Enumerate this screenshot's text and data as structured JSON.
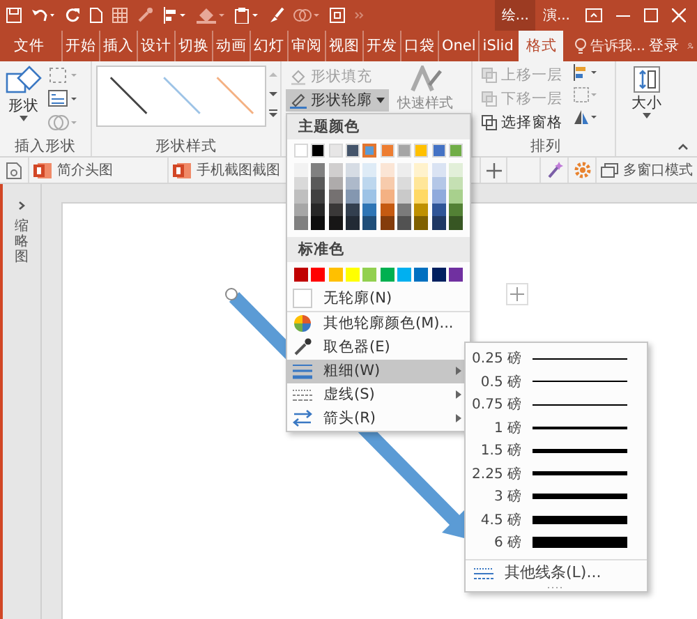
{
  "title_bar": {
    "context_tabs": [
      {
        "label": "绘...",
        "selected": true
      },
      {
        "label": "演...",
        "selected": false
      }
    ]
  },
  "ribbon_tabs": [
    {
      "label": "文件",
      "selected": false
    },
    {
      "label": "开始",
      "selected": false
    },
    {
      "label": "插入",
      "selected": false
    },
    {
      "label": "设计",
      "selected": false
    },
    {
      "label": "切换",
      "selected": false
    },
    {
      "label": "动画",
      "selected": false
    },
    {
      "label": "幻灯",
      "selected": false
    },
    {
      "label": "审阅",
      "selected": false
    },
    {
      "label": "视图",
      "selected": false
    },
    {
      "label": "开发",
      "selected": false
    },
    {
      "label": "口袋",
      "selected": false
    },
    {
      "label": "Onel",
      "selected": false
    },
    {
      "label": "iSlid",
      "selected": false
    },
    {
      "label": "格式",
      "selected": true
    }
  ],
  "tell_me": {
    "placeholder": "告诉我..."
  },
  "account": {
    "label": "登录"
  },
  "insert_shapes": {
    "button": "形状",
    "label": "插入形状"
  },
  "shape_styles": {
    "label": "形状样式"
  },
  "shape_fill": {
    "label": "形状填充",
    "disabled": true
  },
  "shape_outline": {
    "label": "形状轮廓",
    "expanded": true
  },
  "quick_styles": {
    "label": "快速样式"
  },
  "arrange": {
    "items": [
      {
        "label": "上移一层",
        "disabled": true
      },
      {
        "label": "下移一层",
        "disabled": true
      },
      {
        "label": "选择窗格",
        "disabled": false
      }
    ],
    "label": "排列"
  },
  "size": {
    "label": "大小"
  },
  "addin_bar": {
    "items": [
      {
        "label": "简介头图"
      },
      {
        "label": "手机截图截图"
      }
    ],
    "window_mode": "多窗口模式"
  },
  "side_panel": {
    "label": "缩略图"
  },
  "outline_menu": {
    "theme_header": "主题颜色",
    "theme_colors": [
      {
        "color": "#ffffff",
        "selected": false,
        "shades": [
          {
            "color": "#f2f2f2"
          },
          {
            "color": "#d9d9d9"
          },
          {
            "color": "#bfbfbf"
          },
          {
            "color": "#a6a6a6"
          },
          {
            "color": "#808080"
          }
        ]
      },
      {
        "color": "#000000",
        "selected": false,
        "shades": [
          {
            "color": "#808080"
          },
          {
            "color": "#595959"
          },
          {
            "color": "#404040"
          },
          {
            "color": "#262626"
          },
          {
            "color": "#0d0d0d"
          }
        ]
      },
      {
        "color": "#e7e6e6",
        "selected": false,
        "shades": [
          {
            "color": "#d0cece"
          },
          {
            "color": "#aeabab"
          },
          {
            "color": "#757171"
          },
          {
            "color": "#3a3838"
          },
          {
            "color": "#171616"
          }
        ]
      },
      {
        "color": "#44546a",
        "selected": false,
        "shades": [
          {
            "color": "#d6dce4"
          },
          {
            "color": "#adb9ca"
          },
          {
            "color": "#8497b0"
          },
          {
            "color": "#333f4f"
          },
          {
            "color": "#222a35"
          }
        ]
      },
      {
        "color": "#5b9bd5",
        "selected": true,
        "shades": [
          {
            "color": "#deebf6"
          },
          {
            "color": "#bdd7ee"
          },
          {
            "color": "#9dc3e6"
          },
          {
            "color": "#2e75b5"
          },
          {
            "color": "#1f4e79"
          }
        ]
      },
      {
        "color": "#ed7d31",
        "selected": false,
        "shades": [
          {
            "color": "#fbe5d5"
          },
          {
            "color": "#f7cbac"
          },
          {
            "color": "#f4b183"
          },
          {
            "color": "#c55a11"
          },
          {
            "color": "#843c0b"
          }
        ]
      },
      {
        "color": "#a5a5a5",
        "selected": false,
        "shades": [
          {
            "color": "#ededed"
          },
          {
            "color": "#dbdbdb"
          },
          {
            "color": "#c9c9c9"
          },
          {
            "color": "#7b7b7b"
          },
          {
            "color": "#525252"
          }
        ]
      },
      {
        "color": "#ffc000",
        "selected": false,
        "shades": [
          {
            "color": "#fff2cc"
          },
          {
            "color": "#ffe699"
          },
          {
            "color": "#ffd965"
          },
          {
            "color": "#bf9000"
          },
          {
            "color": "#7f6000"
          }
        ]
      },
      {
        "color": "#4472c4",
        "selected": false,
        "shades": [
          {
            "color": "#dae3f3"
          },
          {
            "color": "#b4c7e7"
          },
          {
            "color": "#8faadc"
          },
          {
            "color": "#2f5597"
          },
          {
            "color": "#1f3864"
          }
        ]
      },
      {
        "color": "#70ad47",
        "selected": false,
        "shades": [
          {
            "color": "#e2efd9"
          },
          {
            "color": "#c5e0b3"
          },
          {
            "color": "#a8d08d"
          },
          {
            "color": "#538135"
          },
          {
            "color": "#375623"
          }
        ]
      }
    ],
    "standard_header": "标准色",
    "standard_colors": [
      {
        "color": "#c00000"
      },
      {
        "color": "#ff0000"
      },
      {
        "color": "#ffc000"
      },
      {
        "color": "#ffff00"
      },
      {
        "color": "#92d050"
      },
      {
        "color": "#00b050"
      },
      {
        "color": "#00b0f0"
      },
      {
        "color": "#0070c0"
      },
      {
        "color": "#002060"
      },
      {
        "color": "#7030a0"
      }
    ],
    "items": [
      {
        "kind": "no-outline",
        "label": "无轮廓(N)",
        "selected": false
      },
      {
        "kind": "more-colors",
        "label": "其他轮廓颜色(M)...",
        "selected": false
      },
      {
        "kind": "eyedropper",
        "label": "取色器(E)",
        "selected": false
      },
      {
        "kind": "weight",
        "label": "粗细(W)",
        "submenu": true,
        "selected": true
      },
      {
        "kind": "dash",
        "label": "虚线(S)",
        "submenu": true,
        "selected": false
      },
      {
        "kind": "arrow",
        "label": "箭头(R)",
        "submenu": true,
        "selected": false
      }
    ]
  },
  "weight_menu": {
    "items": [
      {
        "label": "0.25 磅"
      },
      {
        "label": "0.5 磅"
      },
      {
        "label": "0.75 磅"
      },
      {
        "label": "1 磅"
      },
      {
        "label": "1.5 磅"
      },
      {
        "label": "2.25 磅"
      },
      {
        "label": "3 磅"
      },
      {
        "label": "4.5 磅"
      },
      {
        "label": "6 磅"
      }
    ],
    "more": "其他线条(L)..."
  }
}
